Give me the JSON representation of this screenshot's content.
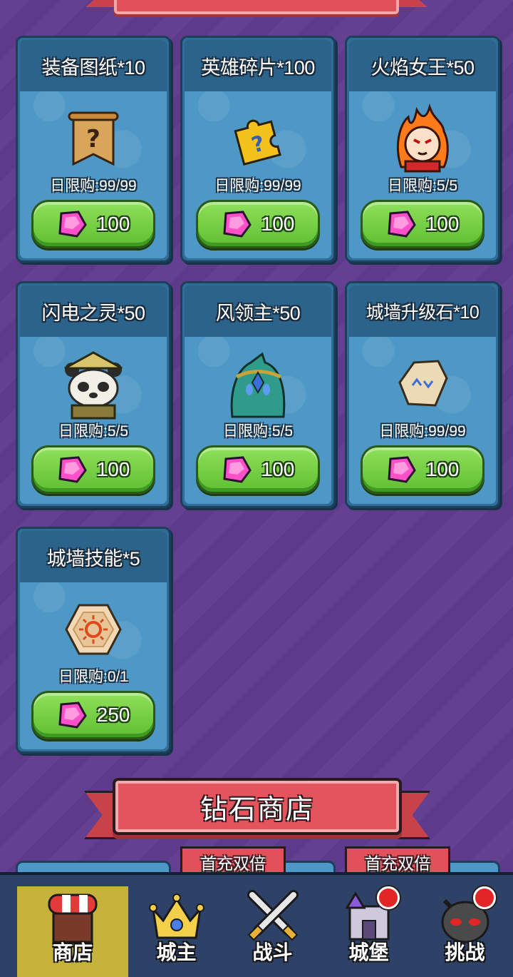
{
  "shop_items": [
    {
      "title": "装备图纸*10",
      "limit": "日限购:99/99",
      "price": "100",
      "icon": "scroll-blueprint-icon"
    },
    {
      "title": "英雄碎片*100",
      "limit": "日限购:99/99",
      "price": "100",
      "icon": "puzzle-piece-icon"
    },
    {
      "title": "火焰女王*50",
      "limit": "日限购:5/5",
      "price": "100",
      "icon": "fire-queen-portrait-icon"
    },
    {
      "title": "闪电之灵*50",
      "limit": "日限购:5/5",
      "price": "100",
      "icon": "panda-warrior-portrait-icon"
    },
    {
      "title": "风领主*50",
      "limit": "日限购:5/5",
      "price": "100",
      "icon": "wind-lord-portrait-icon"
    },
    {
      "title": "城墙升级石*10",
      "limit": "日限购:99/99",
      "price": "100",
      "icon": "rune-stone-icon"
    },
    {
      "title": "城墙技能*5",
      "limit": "日限购:0/1",
      "price": "250",
      "icon": "sun-hexagon-skill-icon"
    }
  ],
  "diamond_shop": {
    "title": "钻石商店",
    "tags": [
      "首充双倍",
      "首充双倍"
    ]
  },
  "bottom_nav": [
    {
      "label": "商店",
      "icon": "shop-stall-icon",
      "active": true,
      "badge": false
    },
    {
      "label": "城主",
      "icon": "crown-icon",
      "active": false,
      "badge": false
    },
    {
      "label": "战斗",
      "icon": "crossed-swords-icon",
      "active": false,
      "badge": false
    },
    {
      "label": "城堡",
      "icon": "castle-icon",
      "active": false,
      "badge": true
    },
    {
      "label": "挑战",
      "icon": "demon-helmet-icon",
      "active": false,
      "badge": true
    }
  ],
  "colors": {
    "background": "#5f3b8d",
    "card": "#4d98c6",
    "button": "#6fcf3e",
    "gem": "#e83ab8",
    "ribbon": "#e2515a",
    "nav": "#2d4266",
    "nav_active": "#c4b23a"
  }
}
